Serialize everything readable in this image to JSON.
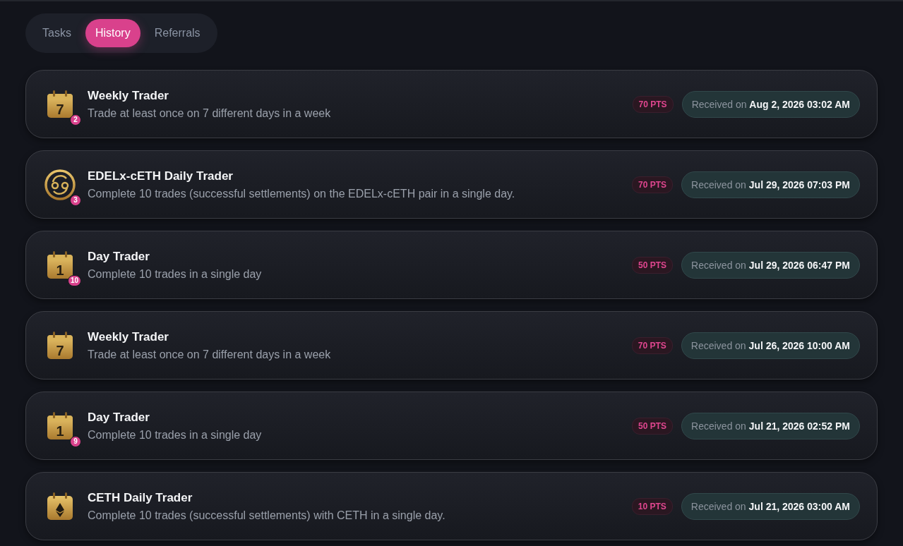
{
  "tabs": [
    {
      "label": "Tasks",
      "selected": false
    },
    {
      "label": "History",
      "selected": true
    },
    {
      "label": "Referrals",
      "selected": false
    }
  ],
  "history": [
    {
      "icon": {
        "kind": "calendar",
        "day": "7"
      },
      "count": "2",
      "title": "Weekly Trader",
      "description": "Trade at least once on 7 different days in a week",
      "points": "70 PTS",
      "received": "Received on **Aug 2, 2026 03:02 AM**"
    },
    {
      "icon": {
        "kind": "swap-coin"
      },
      "count": "3",
      "title": "EDELx-cETH Daily Trader",
      "description": "Complete 10 trades (successful settlements) on the EDELx-cETH pair in a single day.",
      "points": "70 PTS",
      "received": "Received on **Jul 29, 2026 07:03 PM**"
    },
    {
      "icon": {
        "kind": "calendar",
        "day": "1"
      },
      "count": "10",
      "title": "Day Trader",
      "description": "Complete 10 trades in a single day",
      "points": "50 PTS",
      "received": "Received on **Jul 29, 2026 06:47 PM**"
    },
    {
      "icon": {
        "kind": "calendar",
        "day": "7"
      },
      "title": "Weekly Trader",
      "description": "Trade at least once on 7 different days in a week",
      "points": "70 PTS",
      "received": "Received on **Jul 26, 2026 10:00 AM**"
    },
    {
      "icon": {
        "kind": "calendar",
        "day": "1"
      },
      "count": "9",
      "title": "Day Trader",
      "description": "Complete 10 trades in a single day",
      "points": "50 PTS",
      "received": "Received on **Jul 21, 2026 02:52 PM**"
    },
    {
      "icon": {
        "kind": "calendar-eth"
      },
      "title": "CETH Daily Trader",
      "description": "Complete 10 trades (successful settlements) with CETH in a single day.",
      "points": "10 PTS",
      "received": "Received on **Jul 21, 2026 03:00 AM**"
    }
  ]
}
